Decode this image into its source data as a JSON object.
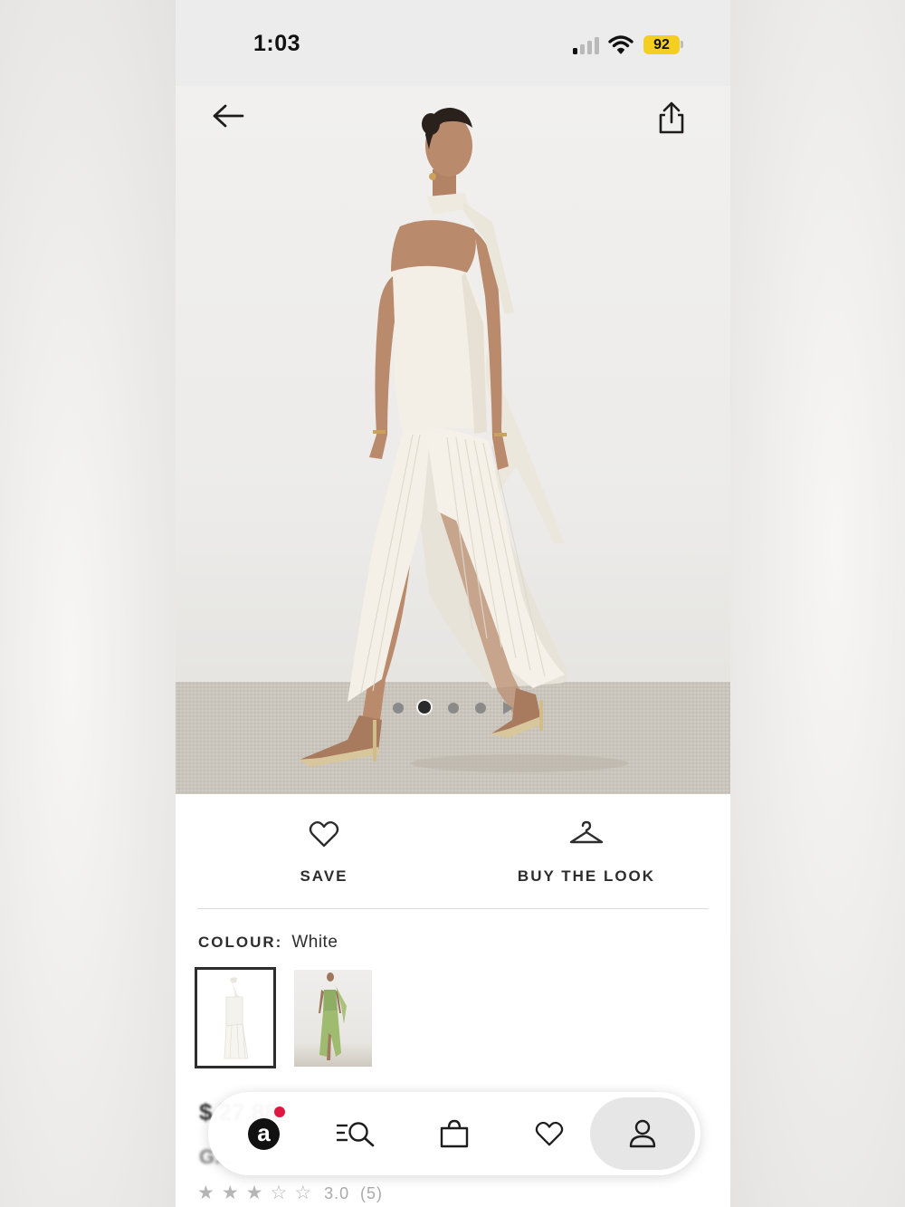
{
  "status_bar": {
    "time": "1:03",
    "battery": "92"
  },
  "product_actions": {
    "save_label": "SAVE",
    "buy_the_look_label": "BUY THE LOOK"
  },
  "colour": {
    "label": "COLOUR:",
    "value": "White"
  },
  "swatches": [
    {
      "name": "White",
      "selected": true
    },
    {
      "name": "Green",
      "selected": false
    }
  ],
  "gallery": {
    "dot_count": 4,
    "active_index": 1
  },
  "price_partial": "$ 27.88",
  "title_partial": "G...",
  "rating": {
    "value": "3.0",
    "count": "(5)",
    "stars": 1
  },
  "tab_bar": {
    "items": [
      "home",
      "search",
      "bag",
      "saved",
      "account"
    ],
    "active": "account",
    "home_notification": true
  },
  "colors": {
    "accent": "#2d2d2d",
    "battery": "#f4cf1f",
    "notification": "#e0173f"
  }
}
